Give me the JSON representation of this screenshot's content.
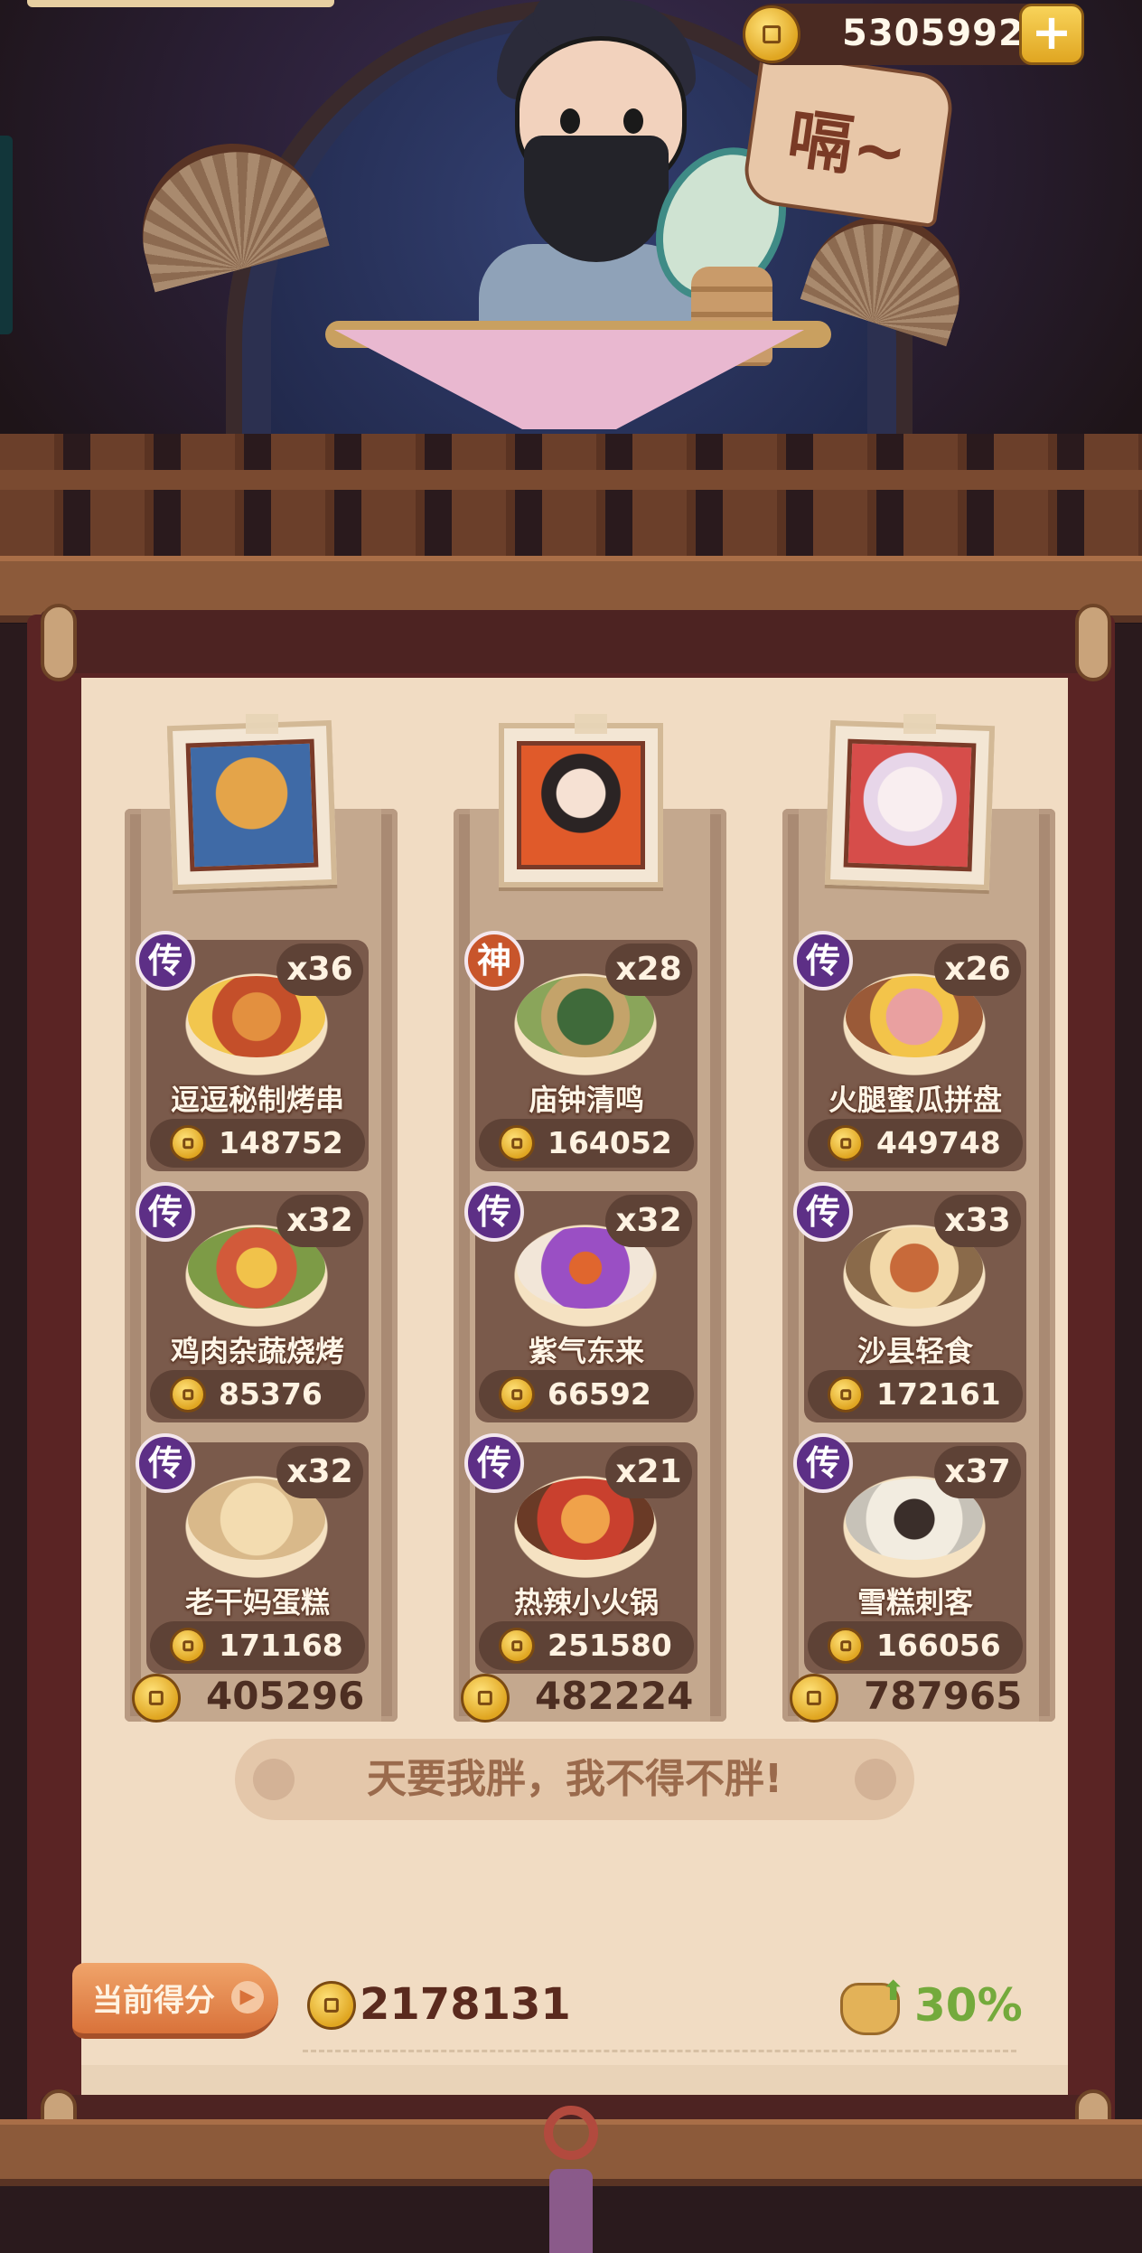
{
  "header": {
    "gold_balance": "5305992",
    "add_button": "+",
    "sign_text": "嗝~"
  },
  "columns": [
    {
      "hero": "bear",
      "dishes": [
        {
          "tier": "传",
          "qty": "x36",
          "name": "逗逗秘制烤串",
          "price": "148752"
        },
        {
          "tier": "传",
          "qty": "x32",
          "name": "鸡肉杂蔬烧烤",
          "price": "85376"
        },
        {
          "tier": "传",
          "qty": "x32",
          "name": "老干妈蛋糕",
          "price": "171168"
        }
      ],
      "total": "405296"
    },
    {
      "hero": "red-hair-girl",
      "dishes": [
        {
          "tier": "神",
          "qty": "x28",
          "name": "庙钟清鸣",
          "price": "164052"
        },
        {
          "tier": "传",
          "qty": "x32",
          "name": "紫气东来",
          "price": "66592"
        },
        {
          "tier": "传",
          "qty": "x21",
          "name": "热辣小火锅",
          "price": "251580"
        }
      ],
      "total": "482224"
    },
    {
      "hero": "white-hair-girl",
      "dishes": [
        {
          "tier": "传",
          "qty": "x26",
          "name": "火腿蜜瓜拼盘",
          "price": "449748"
        },
        {
          "tier": "传",
          "qty": "x33",
          "name": "沙县轻食",
          "price": "172161"
        },
        {
          "tier": "传",
          "qty": "x37",
          "name": "雪糕刺客",
          "price": "166056"
        }
      ],
      "total": "787965"
    }
  ],
  "slogan": "天要我胖，我不得不胖!",
  "score": {
    "label": "当前得分",
    "arrow": "▶",
    "value": "2178131",
    "bonus_percent": "30%"
  },
  "colors": {
    "tier_chuan": "#5d2f86",
    "tier_shen": "#c8552b",
    "bonus_green": "#74aa3c"
  }
}
